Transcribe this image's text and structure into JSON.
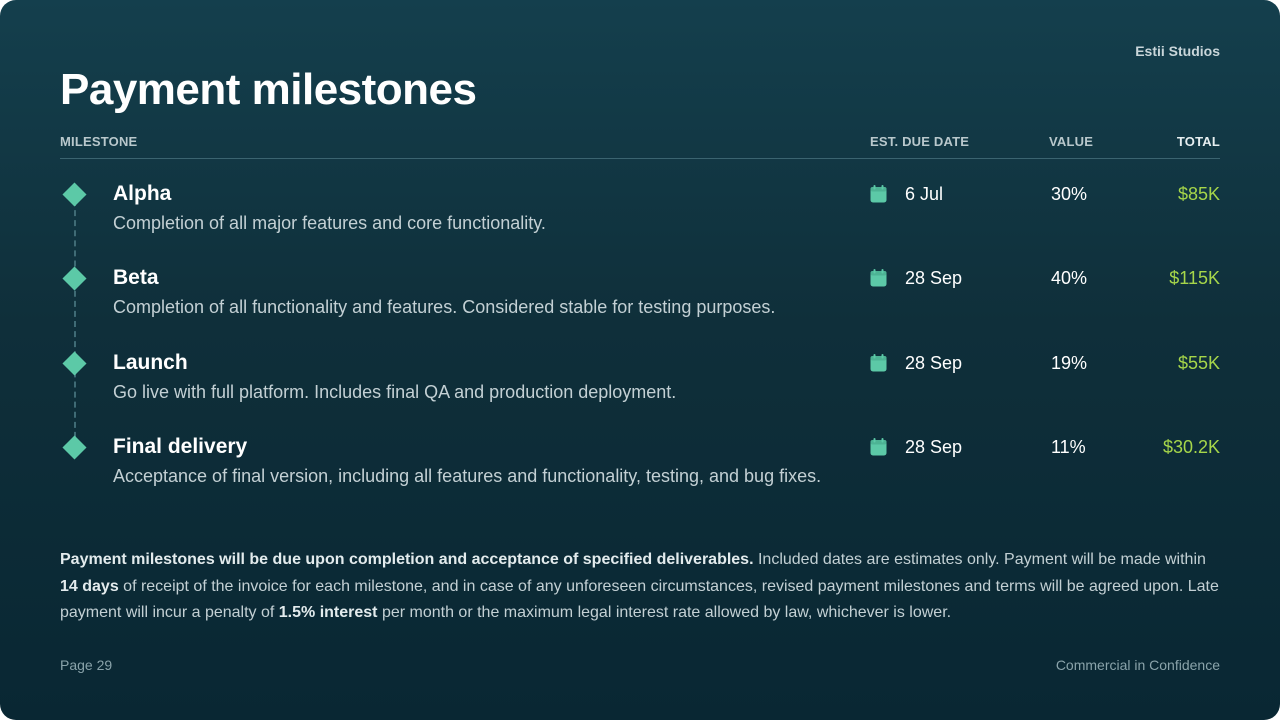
{
  "brand": "Estii Studios",
  "title": "Payment milestones",
  "columns": {
    "milestone": "MILESTONE",
    "due_date": "EST. DUE DATE",
    "value": "VALUE",
    "total": "TOTAL"
  },
  "milestones": [
    {
      "name": "Alpha",
      "description": "Completion of all major features and core functionality.",
      "date": "6 Jul",
      "value": "30%",
      "total": "$85K"
    },
    {
      "name": "Beta",
      "description": "Completion of all functionality and features. Considered stable for testing purposes.",
      "date": "28 Sep",
      "value": "40%",
      "total": "$115K"
    },
    {
      "name": "Launch",
      "description": "Go live with full platform. Includes final QA and production deployment.",
      "date": "28 Sep",
      "value": "19%",
      "total": "$55K"
    },
    {
      "name": "Final delivery",
      "description": "Acceptance of final version, including all features and functionality, testing, and bug fixes.",
      "date": "28 Sep",
      "value": "11%",
      "total": "$30.2K"
    }
  ],
  "terms": {
    "lead_bold": "Payment milestones will be due upon completion and acceptance of specified deliverables.",
    "part1": " Included dates are estimates only. Payment will be made within ",
    "days_bold": "14 days",
    "part2": " of receipt of the invoice for each milestone, and in case of any unforeseen circumstances, revised payment milestones and terms will be agreed upon. Late payment will incur a penalty of ",
    "interest_bold": "1.5% interest",
    "part3": " per month or the maximum legal interest rate allowed by law, whichever is lower."
  },
  "footer": {
    "page": "Page 29",
    "confidentiality": "Commercial in Confidence"
  },
  "icons": {
    "milestone_marker": "diamond-icon",
    "date": "calendar-icon"
  },
  "colors": {
    "accent": "#5cc9a7",
    "total": "#a6d64a",
    "background_top": "#143f4d",
    "background_bottom": "#092733"
  }
}
